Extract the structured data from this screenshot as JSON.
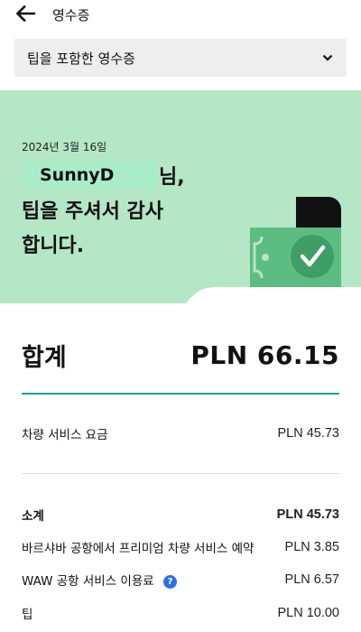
{
  "header": {
    "back_icon": "arrow-left-icon",
    "title": "영수증"
  },
  "receipt_type": {
    "selected": "팁을 포함한 영수증",
    "chevron_icon": "chevron-down-icon"
  },
  "banner": {
    "date": "2024년 3월 16일",
    "name": "SunnyD",
    "name_suffix": "님,",
    "thanks_line1": "팁을 주셔서 감사",
    "thanks_line2": "합니다.",
    "illustration_icon": "cash-check-icon",
    "colors": {
      "background": "#b5e6c6",
      "money": "#5cbc82",
      "dark": "#111111"
    }
  },
  "total": {
    "label": "합계",
    "value": "PLN 66.15"
  },
  "items": {
    "fare": {
      "label": "차량 서비스 요금",
      "value": "PLN 45.73"
    },
    "subtotal": {
      "label": "소계",
      "value": "PLN 45.73"
    },
    "premium_booking": {
      "label": "바르샤바 공항에서 프리미엄 차량 서비스 예약",
      "value": "PLN 3.85"
    },
    "airport_fee": {
      "label": "WAW 공항 서비스 이용료",
      "value": "PLN 6.57",
      "help_icon": "question-circle-icon",
      "help_glyph": "?"
    },
    "tip": {
      "label": "팁",
      "value": "PLN 10.00"
    }
  },
  "accent_color": "#1aa39a"
}
